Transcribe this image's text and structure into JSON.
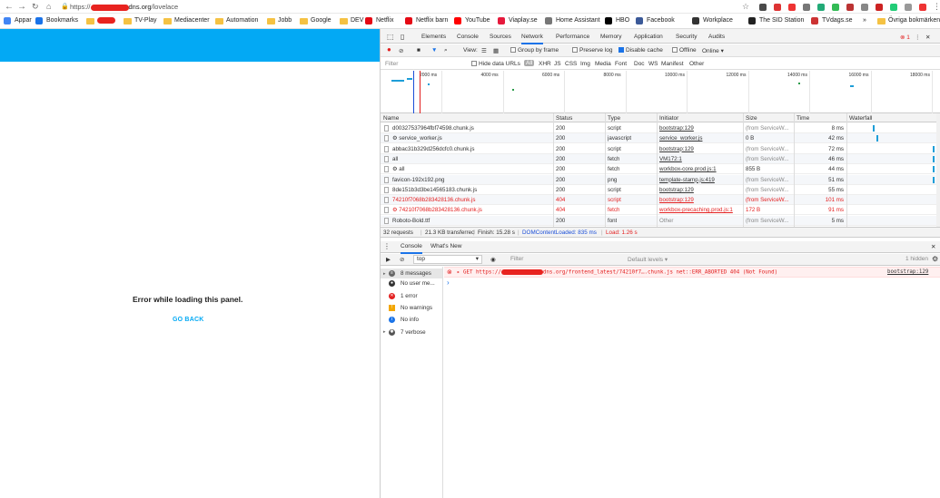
{
  "browser": {
    "url_prefix": "https://",
    "url_host_suffix": "dns.org",
    "url_path": "/lovelace",
    "bookmarks": [
      {
        "label": "Appar",
        "icon": "apps-grid-icon"
      },
      {
        "label": "Bookmarks",
        "icon": "star-icon"
      },
      {
        "label": "",
        "icon": "folder-icon",
        "redacted": true
      },
      {
        "label": "TV-Play",
        "icon": "folder-icon"
      },
      {
        "label": "Mediacenter",
        "icon": "folder-icon"
      },
      {
        "label": "Automation",
        "icon": "folder-icon"
      },
      {
        "label": "Jobb",
        "icon": "folder-icon"
      },
      {
        "label": "Google",
        "icon": "folder-icon"
      },
      {
        "label": "DEV",
        "icon": "folder-icon"
      },
      {
        "label": "Netflix",
        "icon": "netflix-icon"
      },
      {
        "label": "Netflix barn",
        "icon": "netflix-icon"
      },
      {
        "label": "YouTube",
        "icon": "youtube-icon"
      },
      {
        "label": "Viaplay.se",
        "icon": "viaplay-icon"
      },
      {
        "label": "Home Assistant",
        "icon": "globe-icon"
      },
      {
        "label": "HBO",
        "icon": "hbo-icon"
      },
      {
        "label": "Facebook",
        "icon": "facebook-icon"
      },
      {
        "label": "Workplace",
        "icon": "workplace-icon"
      },
      {
        "label": "The SID Station",
        "icon": "sid-icon"
      },
      {
        "label": "TVdags.se",
        "icon": "tv-icon"
      },
      {
        "label": "»",
        "icon": ""
      },
      {
        "label": "Övriga bokmärken",
        "icon": "folder-icon"
      }
    ]
  },
  "app": {
    "error_text": "Error while loading this panel.",
    "go_back": "GO BACK",
    "header_color": "#03a9f4"
  },
  "devtools": {
    "tabs": [
      "Elements",
      "Console",
      "Sources",
      "Network",
      "Performance",
      "Memory",
      "Application",
      "Security",
      "Audits"
    ],
    "active_tab": "Network",
    "error_count": "1",
    "toolbar": {
      "view": "View:",
      "group_by_frame": "Group by frame",
      "preserve_log": "Preserve log",
      "disable_cache": "Disable cache",
      "offline": "Offline",
      "online": "Online"
    },
    "filter": {
      "placeholder": "Filter",
      "hide_data_urls": "Hide data URLs",
      "types": [
        "All",
        "XHR",
        "JS",
        "CSS",
        "Img",
        "Media",
        "Font",
        "Doc",
        "WS",
        "Manifest",
        "Other"
      ]
    },
    "overview_ticks": [
      "2000 ms",
      "4000 ms",
      "6000 ms",
      "8000 ms",
      "10000 ms",
      "12000 ms",
      "14000 ms",
      "16000 ms",
      "18000 ms"
    ],
    "columns": [
      "Name",
      "Status",
      "Type",
      "Initiator",
      "Size",
      "Time",
      "Waterfall"
    ],
    "rows": [
      {
        "name": "d00327537964fbf74598.chunk.js",
        "status": "200",
        "type": "script",
        "initiator": "bootstrap:129",
        "size": "(from ServiceW...",
        "time": "8 ms",
        "err": false,
        "wf": 0.27
      },
      {
        "name": "⚙ service_worker.js",
        "status": "200",
        "type": "javascript",
        "initiator": "service_worker.js",
        "size": "0 B",
        "time": "42 ms",
        "err": false,
        "wf": 0.31
      },
      {
        "name": "abbac31b329d256dcfc0.chunk.js",
        "status": "200",
        "type": "script",
        "initiator": "bootstrap:129",
        "size": "(from ServiceW...",
        "time": "72 ms",
        "err": false,
        "wf": 0.95
      },
      {
        "name": "all",
        "status": "200",
        "type": "fetch",
        "initiator": "VM172:1",
        "size": "(from ServiceW...",
        "time": "46 ms",
        "err": false,
        "wf": 0.95
      },
      {
        "name": "⚙ all",
        "status": "200",
        "type": "fetch",
        "initiator": "workbox-core.prod.js:1",
        "size": "855 B",
        "time": "44 ms",
        "err": false,
        "wf": 0.95
      },
      {
        "name": "favicon-192x192.png",
        "status": "200",
        "type": "png",
        "initiator": "template-stamp.js:419",
        "size": "(from ServiceW...",
        "time": "51 ms",
        "err": false,
        "wf": 0.95
      },
      {
        "name": "8de151b3d3be14565183.chunk.js",
        "status": "200",
        "type": "script",
        "initiator": "bootstrap:129",
        "size": "(from ServiceW...",
        "time": "55 ms",
        "err": false,
        "wf": 0.99
      },
      {
        "name": "74210f7068b283428136.chunk.js",
        "status": "404",
        "type": "script",
        "initiator": "bootstrap:129",
        "size": "(from ServiceW...",
        "time": "101 ms",
        "err": true,
        "wf": 0.99
      },
      {
        "name": "⚙ 74210f7068b283428136.chunk.js",
        "status": "404",
        "type": "fetch",
        "initiator": "workbox-precaching.prod.js:1",
        "size": "172 B",
        "time": "91 ms",
        "err": true,
        "wf": 0.99
      },
      {
        "name": "Roboto-Bold.ttf",
        "status": "200",
        "type": "font",
        "initiator": "Other",
        "size": "(from ServiceW...",
        "time": "5 ms",
        "err": false,
        "wf": 0.99
      }
    ],
    "summary": {
      "requests": "32 requests",
      "transferred": "21.3 KB transferred",
      "finish": "Finish: 15.28 s",
      "dcl": "DOMContentLoaded: 835 ms",
      "load": "Load: 1.26 s"
    },
    "drawer_tabs": [
      "Console",
      "What's New"
    ],
    "console": {
      "context": "top",
      "filter_placeholder": "Filter",
      "levels": "Default levels ▾",
      "hidden": "1 hidden",
      "sidebar": [
        {
          "label": "8 messages",
          "icon": "list-icon"
        },
        {
          "label": "No user me...",
          "icon": "user-icon"
        },
        {
          "label": "1 error",
          "icon": "error-icon"
        },
        {
          "label": "No warnings",
          "icon": "warning-icon"
        },
        {
          "label": "No info",
          "icon": "info-icon"
        },
        {
          "label": "7 verbose",
          "icon": "bug-icon"
        }
      ],
      "message_prefix": "▸ GET https://",
      "message_suffix": "dns.org/frontend_latest/74210f7….chunk.js net::ERR_ABORTED 404 (Not Found)",
      "message_source": "bootstrap:129",
      "prompt": "›"
    }
  }
}
